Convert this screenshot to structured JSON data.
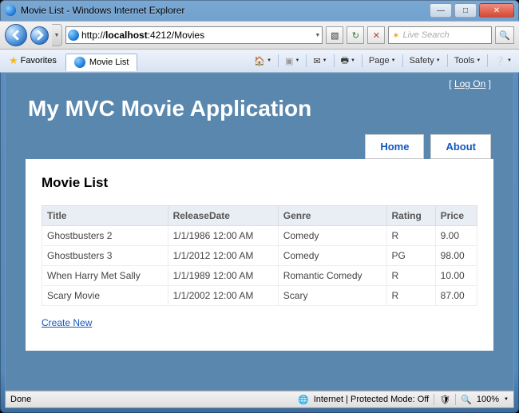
{
  "window": {
    "title": "Movie List - Windows Internet Explorer",
    "url_prefix": "http://",
    "url_host": "localhost",
    "url_rest": ":4212/Movies",
    "search_placeholder": "Live Search"
  },
  "favorites_label": "Favorites",
  "tab_label": "Movie List",
  "cmdbar": {
    "page": "Page",
    "safety": "Safety",
    "tools": "Tools"
  },
  "logon": "Log On",
  "app_title": "My MVC Movie Application",
  "menu": {
    "home": "Home",
    "about": "About"
  },
  "panel_heading": "Movie List",
  "columns": {
    "title": "Title",
    "releaseDate": "ReleaseDate",
    "genre": "Genre",
    "rating": "Rating",
    "price": "Price"
  },
  "rows": [
    {
      "title": "Ghostbusters 2",
      "releaseDate": "1/1/1986 12:00 AM",
      "genre": "Comedy",
      "rating": "R",
      "price": "9.00"
    },
    {
      "title": "Ghostbusters 3",
      "releaseDate": "1/1/2012 12:00 AM",
      "genre": "Comedy",
      "rating": "PG",
      "price": "98.00"
    },
    {
      "title": "When Harry Met Sally",
      "releaseDate": "1/1/1989 12:00 AM",
      "genre": "Romantic Comedy",
      "rating": "R",
      "price": "10.00"
    },
    {
      "title": "Scary Movie",
      "releaseDate": "1/1/2002 12:00 AM",
      "genre": "Scary",
      "rating": "R",
      "price": "87.00"
    }
  ],
  "create_new": "Create New",
  "status": {
    "done": "Done",
    "zone": "Internet | Protected Mode: Off",
    "zoom": "100%"
  }
}
